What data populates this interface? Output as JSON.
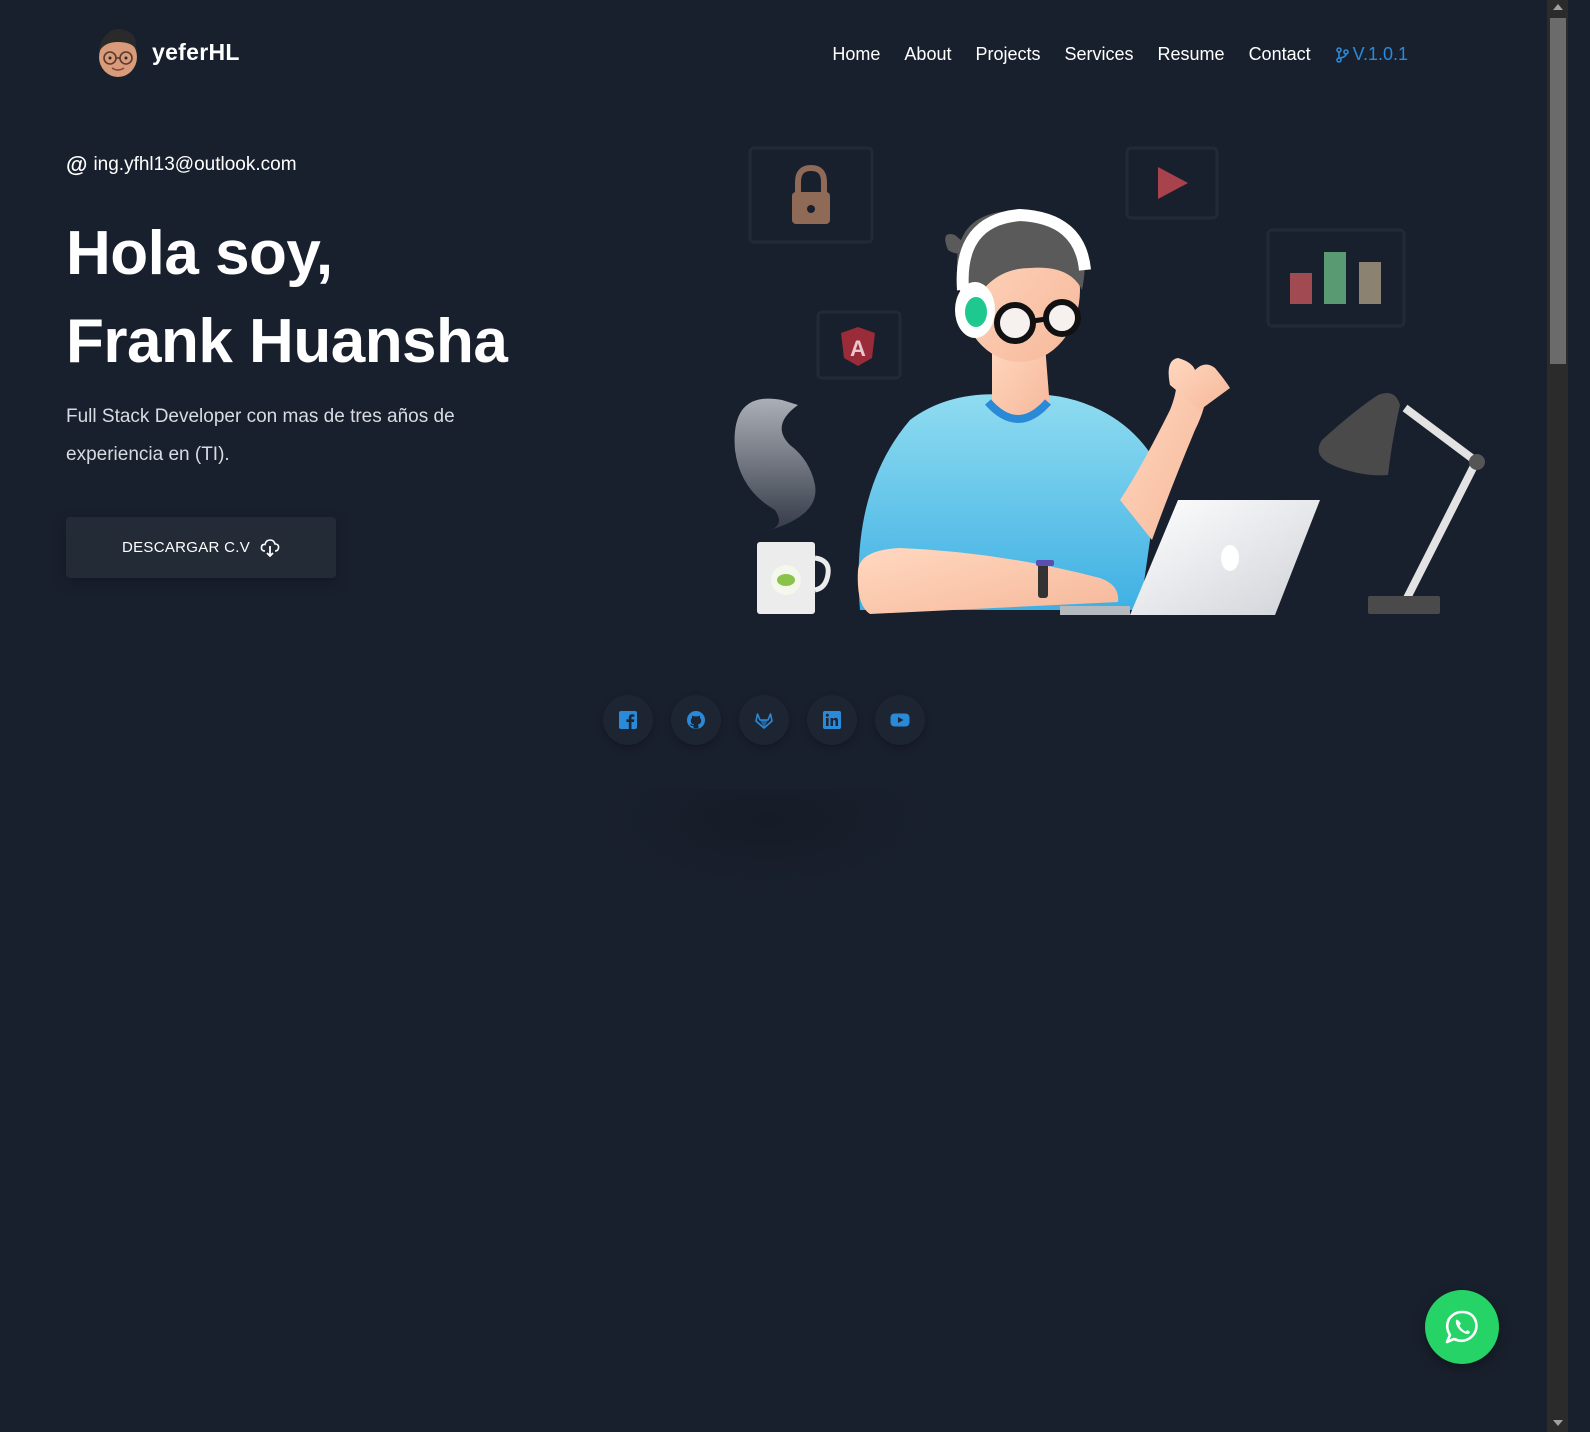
{
  "brand": {
    "name_bold": "yefer",
    "name_rest": "HL",
    "avatar_icon": "developer-avatar-icon"
  },
  "nav": {
    "items": [
      "Home",
      "About",
      "Projects",
      "Services",
      "Resume",
      "Contact"
    ],
    "version": "V.1.0.1",
    "version_icon": "git-branch-icon",
    "accent": "#2a8ad8"
  },
  "hero": {
    "email": "ing.yfhl13@outlook.com",
    "email_icon": "at-icon",
    "title_line1": "Hola soy,",
    "title_line2": "Frank Huansha",
    "description": "Full Stack Developer con mas de tres años de experiencia en (TI).",
    "cv_button": "DESCARGAR C.V",
    "cv_icon": "cloud-download-icon"
  },
  "social": {
    "icons": [
      "facebook-icon",
      "github-icon",
      "gitlab-icon",
      "linkedin-icon",
      "youtube-icon"
    ],
    "color": "#2a8ad8"
  },
  "whatsapp": {
    "icon": "whatsapp-icon",
    "color": "#25d366"
  },
  "background": "#19202d"
}
